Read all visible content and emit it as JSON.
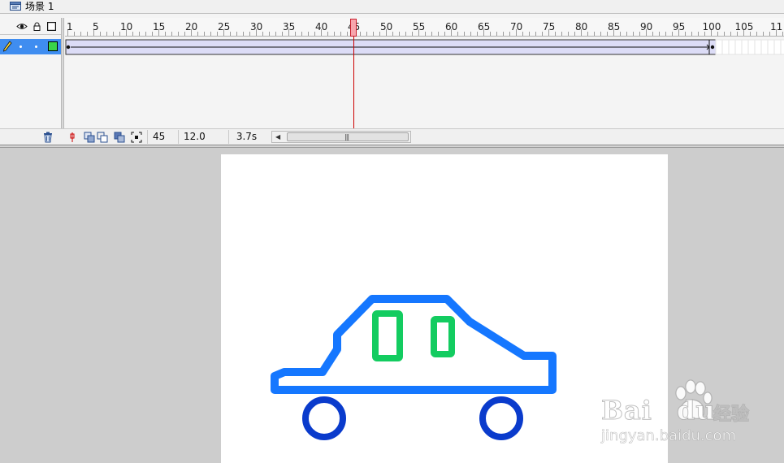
{
  "scene": {
    "label": "场景 1"
  },
  "timeline": {
    "ruler_labels": [
      "1",
      "5",
      "10",
      "15",
      "20",
      "25",
      "30",
      "35",
      "40",
      "45",
      "50",
      "55",
      "60",
      "65",
      "70",
      "75",
      "80",
      "85",
      "90",
      "95",
      "100",
      "105",
      "11"
    ],
    "current_frame": 45,
    "tween_start_frame": 1,
    "tween_end_frame": 100,
    "layer": {
      "color": "#3ad34a",
      "selected_color": "#3f8df0"
    }
  },
  "status": {
    "frame": "45",
    "fps": "12.0 fps",
    "time": "3.7s"
  },
  "stage": {
    "background": "#ffffff",
    "car_body_color": "#1577ff",
    "window_color": "#13cc60",
    "wheel_color": "#0a3bcc"
  },
  "watermark": {
    "brand": "Bai",
    "brand_tail": "du",
    "cn": "经验",
    "url": "jingyan.baidu.com"
  }
}
